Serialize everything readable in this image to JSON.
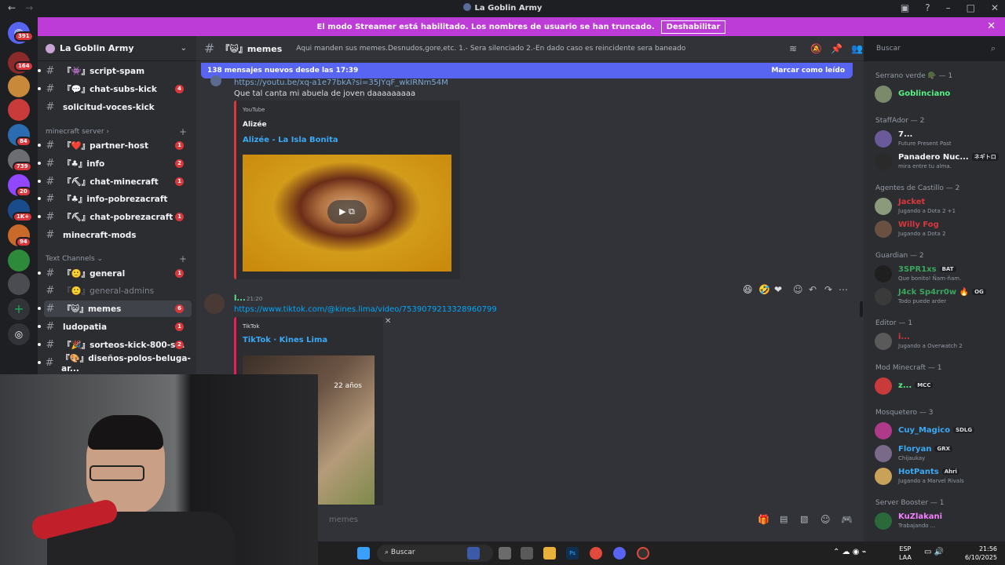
{
  "window": {
    "title": "La Goblin Army"
  },
  "banner": {
    "text": "El modo Streamer está habilitado. Los nombres de usuario se han truncado.",
    "button": "Deshabilitar"
  },
  "guild_badges": [
    "391",
    "164",
    "84",
    "739",
    "20",
    "1K+",
    "94"
  ],
  "server": {
    "name": "La Goblin Army"
  },
  "channels": [
    {
      "label": "『👾』script-spam",
      "count": ""
    },
    {
      "label": "『💬』chat-subs-kick",
      "count": "4"
    },
    {
      "label": "solicitud-voces-kick",
      "count": ""
    },
    {
      "label": "『❤️』partner-host",
      "count": "1"
    },
    {
      "label": "『♣』info",
      "count": "2"
    },
    {
      "label": "『⛏』chat-minecraft",
      "count": "1"
    },
    {
      "label": "『♣』info-pobrezacraft",
      "count": ""
    },
    {
      "label": "『⛏』chat-pobrezacraft",
      "count": "1"
    },
    {
      "label": "minecraft-mods",
      "count": ""
    },
    {
      "label": "『🙂』general",
      "count": "1"
    },
    {
      "label": "『🙂』general-admins",
      "count": ""
    },
    {
      "label": "『😺』memes",
      "count": "6"
    },
    {
      "label": "ludopatia",
      "count": "1"
    },
    {
      "label": "『🎉』sorteos-kick-800-s...",
      "count": "2"
    },
    {
      "label": "『🎨』diseños-polos-beluga-ar...",
      "count": ""
    }
  ],
  "categories": {
    "minecraft": "minecraft server  ›",
    "text": "Text Channels  ⌄"
  },
  "channel_header": {
    "name": "『😺』memes",
    "topic": "Aqui manden sus memes.Desnudos,gore,etc. 1.- Sera silenciado 2.-En dado caso es reincidente sera baneado"
  },
  "search": {
    "placeholder": "Buscar"
  },
  "new_messages": {
    "text": "138 mensajes nuevos desde las 17:39",
    "mark": "Marcar como leído"
  },
  "messages": {
    "yt_link": "https://youtu.be/xq-a1e77bkA?si=35JYqF_wkIRNm54M",
    "yt_text": "Que tal canta mi abuela de joven daaaaaaaaa",
    "yt_provider": "YouTube",
    "yt_author": "Alizée",
    "yt_title": "Alizée - La Isla Bonita",
    "tt_user": "l...",
    "tt_time": "21:20",
    "tt_link": "https://www.tiktok.com/@kines.lima/video/7539079213328960799",
    "tt_provider": "TikTok",
    "tt_title": "TikTok · Kines Lima",
    "tt_overlay": "22 años"
  },
  "composer": {
    "placeholder": "memes"
  },
  "member_groups": [
    {
      "title": "Serrano verde 🪖 — 1",
      "members": [
        {
          "name": "Goblinciano",
          "status": "",
          "color": "#57f287",
          "tag": ""
        }
      ]
    },
    {
      "title": "StaffAdor — 2",
      "members": [
        {
          "name": "7...",
          "status": "Future Present Past",
          "color": "#f2f3f5",
          "tag": ""
        },
        {
          "name": "Panadero Nuc...",
          "status": "mira entre tu alma.",
          "color": "#f2f3f5",
          "tag": "ネギトロ"
        }
      ]
    },
    {
      "title": "Agentes de Castillo — 2",
      "members": [
        {
          "name": "Jacket",
          "status": "Jugando a Dota 2 +1",
          "color": "#da373c",
          "tag": ""
        },
        {
          "name": "Willy Fog",
          "status": "Jugando a Dota 2",
          "color": "#da373c",
          "tag": ""
        }
      ]
    },
    {
      "title": "Guardian — 2",
      "members": [
        {
          "name": "3SPR1xs",
          "status": "Que bonito! Ñam-ñam.",
          "color": "#3ba55c",
          "tag": "BAT"
        },
        {
          "name": "J4ck Sp4rr0w 🔥",
          "status": "Todo puede arder",
          "color": "#3ba55c",
          "tag": "OG"
        }
      ]
    },
    {
      "title": "Editor — 1",
      "members": [
        {
          "name": "i...",
          "status": "Jugando a Overwatch 2",
          "color": "#da373c",
          "tag": ""
        }
      ]
    },
    {
      "title": "Mod Minecraft — 1",
      "members": [
        {
          "name": "z...",
          "status": "",
          "color": "#57f287",
          "tag": "MCC"
        }
      ]
    },
    {
      "title": "Mosquetero — 3",
      "members": [
        {
          "name": "Cuy_Magico",
          "status": "",
          "color": "#3ba9f5",
          "tag": "SDLG"
        },
        {
          "name": "Floryan",
          "status": "Chijaukay",
          "color": "#3ba9f5",
          "tag": "GRX"
        },
        {
          "name": "HotPants",
          "status": "Jugando a Marvel Rivals",
          "color": "#3ba9f5",
          "tag": "Ahri"
        }
      ]
    },
    {
      "title": "Server Booster — 1",
      "members": [
        {
          "name": "KuZlakani",
          "status": "Trabajando ...",
          "color": "#f47fff",
          "tag": ""
        }
      ]
    }
  ],
  "taskbar": {
    "search": "Buscar",
    "lang": "ESP",
    "lang2": "LAA",
    "time": "21:56",
    "date": "6/10/2025"
  }
}
